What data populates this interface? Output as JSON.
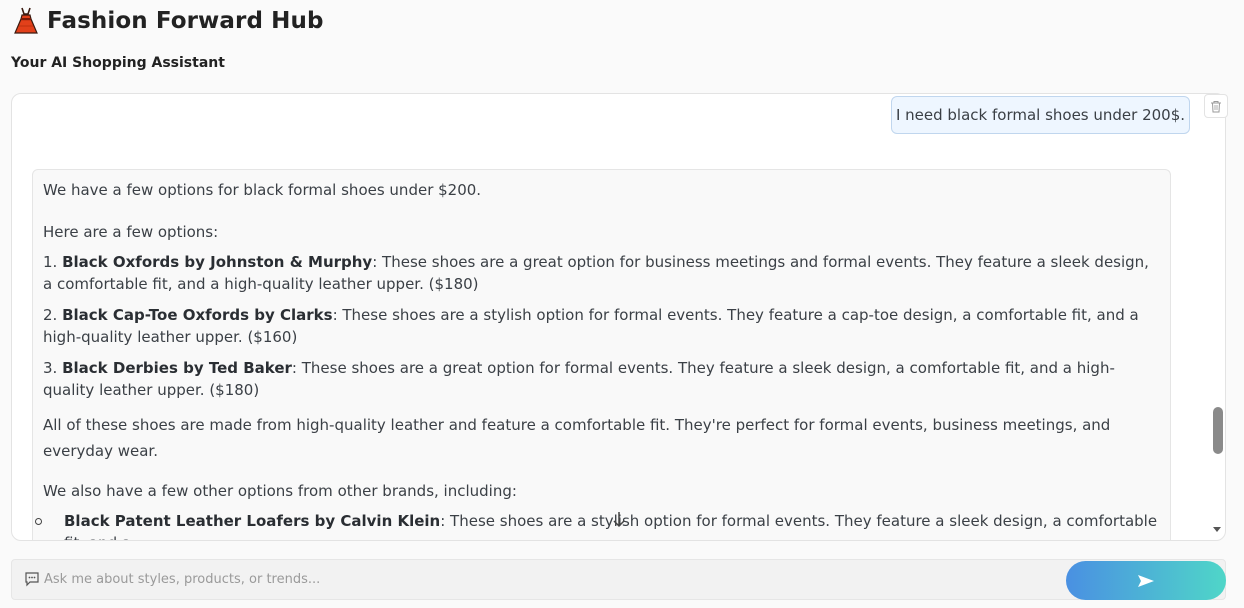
{
  "header": {
    "logo_icon": "dress-icon",
    "title": "Fashion Forward Hub",
    "subtitle": "Your AI Shopping Assistant"
  },
  "chat": {
    "user_message": "I need black formal shoes under 200$.",
    "bot": {
      "intro": "We have a few options for black formal shoes under $200.",
      "here": "Here are a few options:",
      "options": [
        {
          "num": "1. ",
          "name": "Black Oxfords by Johnston & Murphy",
          "desc": ": These shoes are a great option for business meetings and formal events. They feature a sleek design, a comfortable fit, and a high-quality leather upper. ($180)"
        },
        {
          "num": "2. ",
          "name": "Black Cap-Toe Oxfords by Clarks",
          "desc": ": These shoes are a stylish option for formal events. They feature a cap-toe design, a comfortable fit, and a high-quality leather upper. ($160)"
        },
        {
          "num": "3. ",
          "name": "Black Derbies by Ted Baker",
          "desc": ": These shoes are a great option for formal events. They feature a sleek design, a comfortable fit, and a high-quality leather upper. ($180)"
        }
      ],
      "summary": "All of these shoes are made from high-quality leather and feature a comfortable fit. They're perfect for formal events, business meetings, and everyday wear.",
      "also": "We also have a few other options from other brands, including:",
      "others": [
        {
          "name": "Black Patent Leather Loafers by Calvin Klein",
          "desc": ": These shoes are a stylish option for formal events. They feature a sleek design, a comfortable fit, and a"
        }
      ]
    },
    "icons": {
      "trash": "trash-icon",
      "jump": "arrow-down-icon"
    }
  },
  "input": {
    "placeholder": "Ask me about styles, products, or trends...",
    "icon": "chat-bubble-icon",
    "send_icon": "send-icon"
  },
  "colors": {
    "send_gradient_start": "#4a90e2",
    "send_gradient_end": "#4fd6c8",
    "user_bubble_bg": "#eef6ff"
  }
}
